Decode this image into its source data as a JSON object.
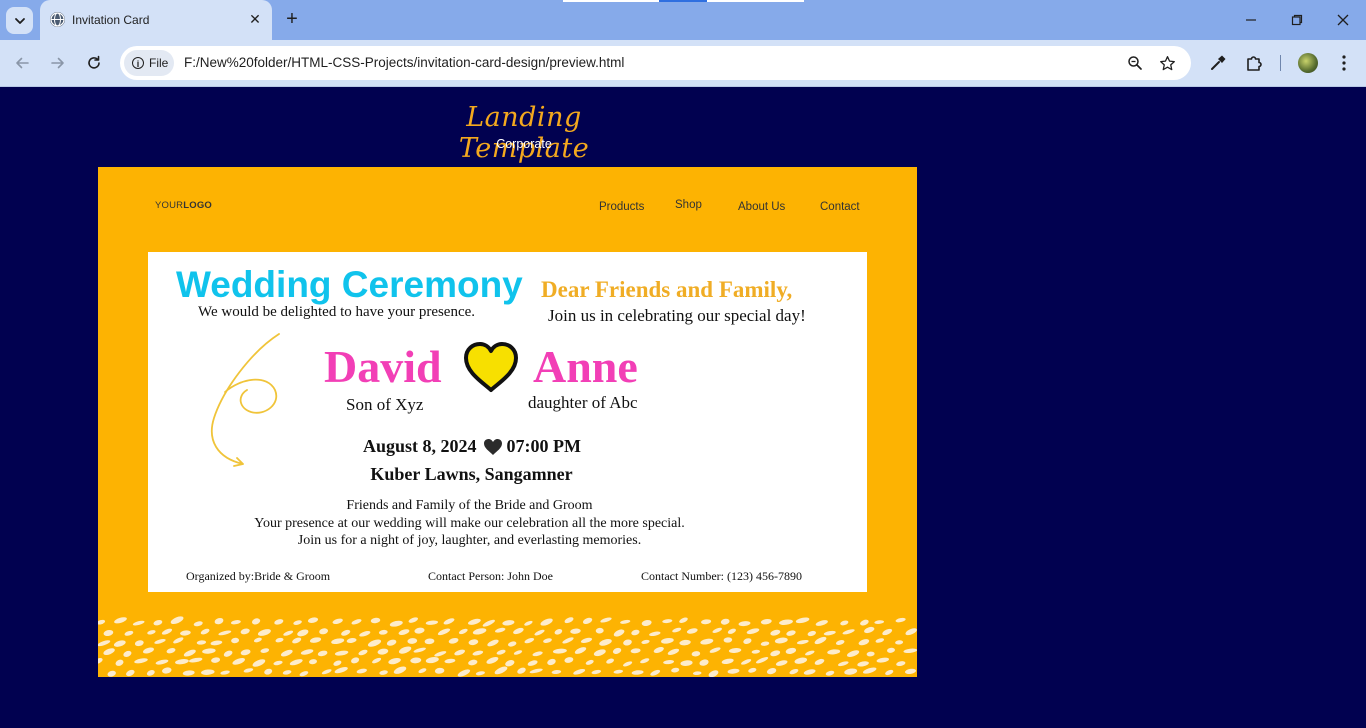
{
  "browser": {
    "tab_title": "Invitation Card",
    "url_chip": "File",
    "url": "F:/New%20folder/HTML-CSS-Projects/invitation-card-design/preview.html"
  },
  "page": {
    "brand_title": "Landing Template",
    "brand_subtitle": "Corporate",
    "logo_light": "YOUR",
    "logo_bold": "LOGO",
    "nav": [
      "Products",
      "Shop",
      "About Us",
      "Contact"
    ],
    "invite": {
      "title": "Wedding Ceremony",
      "subtitle": "We would be delighted to have your presence.",
      "greeting": "Dear Friends and Family,",
      "greeting_sub": "Join us in celebrating our special day!",
      "groom": "David",
      "groom_sub": "Son of Xyz",
      "bride": "Anne",
      "bride_sub": "daughter of Abc",
      "date": "August 8, 2024",
      "time": "07:00 PM",
      "venue": "Kuber Lawns, Sangamner",
      "message_1": "Friends and Family of the Bride and Groom",
      "message_2": "Your presence at our wedding will make our celebration all the more special.",
      "message_3": "Join us for a night of joy, laughter, and everlasting memories.",
      "organized_by": "Organized by:Bride & Groom",
      "contact_person": "Contact Person: John Doe",
      "contact_number": "Contact Number: (123) 456-7890"
    }
  },
  "colors": {
    "page_bg": "#010150",
    "card_bg": "#fdb302",
    "title_cyan": "#10c3ec",
    "names_pink": "#f23fb6",
    "greeting_gold": "#f0ad25",
    "heart_yellow": "#f7e000"
  }
}
